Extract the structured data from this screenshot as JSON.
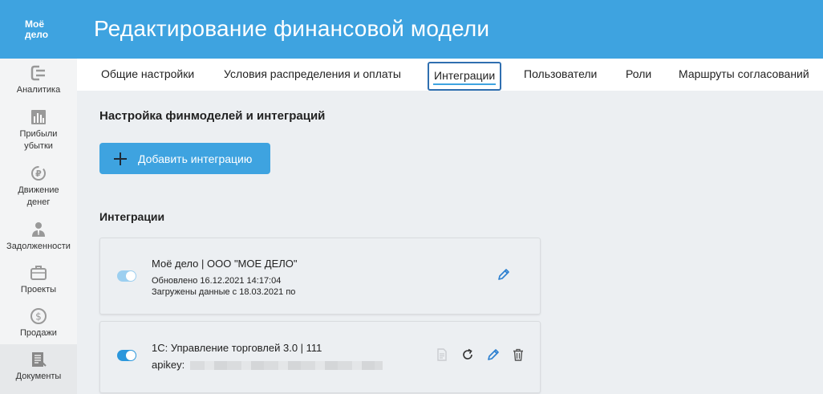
{
  "header": {
    "logo_line1": "Моё",
    "logo_line2": "дело",
    "title": "Редактирование финансовой модели"
  },
  "sidebar": {
    "items": [
      {
        "label": "Аналитика",
        "icon": "analytics-icon"
      },
      {
        "label": "Прибыли\nубытки",
        "line1": "Прибыли",
        "line2": "убытки",
        "icon": "bar-chart-icon"
      },
      {
        "label": "Движение денег",
        "line1": "Движение",
        "line2": "денег",
        "icon": "ruble-cycle-icon"
      },
      {
        "label": "Задолженности",
        "icon": "debtor-person-icon"
      },
      {
        "label": "Проекты",
        "icon": "briefcase-icon"
      },
      {
        "label": "Продажи",
        "icon": "dollar-coin-icon"
      },
      {
        "label": "Документы",
        "icon": "documents-icon"
      }
    ]
  },
  "tabs": [
    {
      "label": "Общие настройки"
    },
    {
      "label": "Условия распределения и оплаты"
    },
    {
      "label": "Интеграции",
      "active": true
    },
    {
      "label": "Пользователи"
    },
    {
      "label": "Роли"
    },
    {
      "label": "Маршруты согласований"
    }
  ],
  "main": {
    "section_title": "Настройка финмоделей и интеграций",
    "add_button_label": "Добавить интеграцию",
    "integrations_title": "Интеграции"
  },
  "integrations": [
    {
      "name": "Моё дело | ООО \"МОЕ ДЕЛО\"",
      "updated": "Обновлено 16.12.2021 14:17:04",
      "loaded": "Загружены данные с 18.03.2021 по",
      "enabled": true
    },
    {
      "name": "1С: Управление торговлей 3.0 | 111",
      "apikey_label": "apikey:",
      "enabled": true
    }
  ],
  "colors": {
    "header": "#3ea3e0",
    "accent": "#3ea3e0",
    "active_tab_border": "#2f6fb0",
    "edit_icon": "#2b7fd0"
  }
}
